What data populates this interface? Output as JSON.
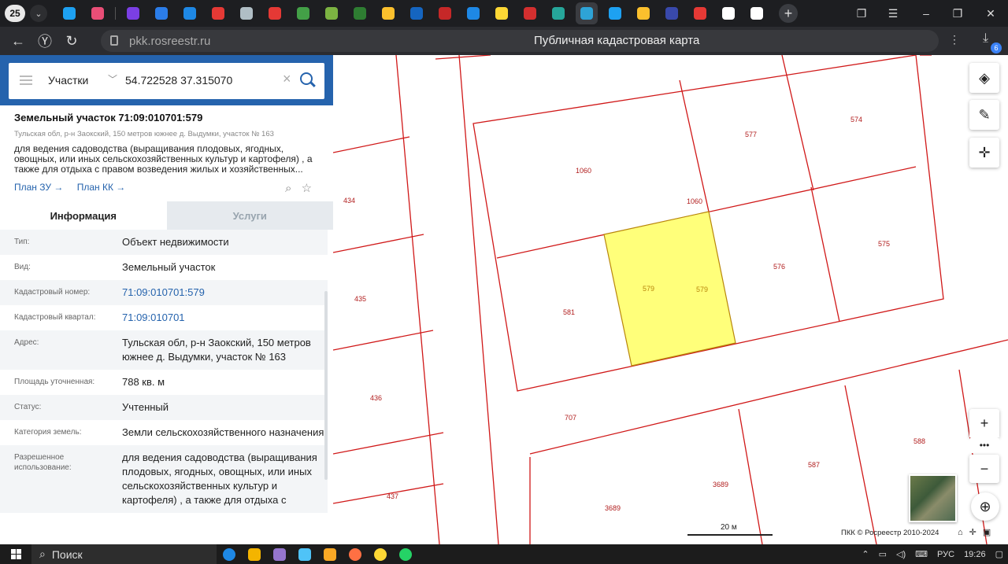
{
  "browser": {
    "tab_count": "25",
    "url": "pkk.rosreestr.ru",
    "page_title": "Публичная кадастровая карта",
    "downloads_badge": "6",
    "favicons": [
      "#1da1f2",
      "#e94e77",
      "#7b3fe4",
      "#2b7de9",
      "#1e88e5",
      "#e53935",
      "#b0bec5",
      "#e53935",
      "#43a047",
      "#7cb342",
      "#2e7d32",
      "#fbc02d",
      "#1565c0",
      "#c62828",
      "#1e88e5",
      "#fdd835",
      "#d32f2f",
      "#26a69a",
      "#2ea3d6",
      "#1da1f2",
      "#fbc02d",
      "#3949ab",
      "#e53935",
      "#ffffff",
      "#ffffff"
    ]
  },
  "search": {
    "type_label": "Участки",
    "value": "54.722528 37.315070"
  },
  "parcel": {
    "title": "Земельный участок 71:09:010701:579",
    "address_small": "Тульская обл, р-н Заокский, 150 метров южнее д. Выдумки, участок № 163",
    "description": "для ведения садоводства (выращивания плодовых, ягодных, овощных, или иных сельскохозяйственных культур и картофеля) , а также для отдыха с правом возведения жилых и хозяйственных...",
    "link_plan_zu": "План ЗУ →",
    "link_plan_kk": "План КК →"
  },
  "panel_tabs": {
    "info": "Информация",
    "services": "Услуги"
  },
  "info_rows": [
    {
      "label": "Тип:",
      "value": "Объект недвижимости"
    },
    {
      "label": "Вид:",
      "value": "Земельный участок"
    },
    {
      "label": "Кадастровый номер:",
      "value": "71:09:010701:579"
    },
    {
      "label": "Кадастровый квартал:",
      "value": "71:09:010701"
    },
    {
      "label": "Адрес:",
      "value": "Тульская обл, р-н Заокский, 150 метров южнее д. Выдумки, участок № 163"
    },
    {
      "label": "Площадь уточненная:",
      "value": "788 кв. м"
    },
    {
      "label": "Статус:",
      "value": "Учтенный"
    },
    {
      "label": "Категория земель:",
      "value": "Земли сельскохозяйственного назначения"
    },
    {
      "label": "Разрешенное использование:",
      "value": "для ведения садоводства (выращивания плодовых, ягодных, овощных, или иных сельскохозяйственных культур и картофеля) , а также для отдыха с"
    }
  ],
  "map": {
    "labels": [
      "1060",
      "1060",
      "577",
      "574",
      "434",
      "575",
      "576",
      "579",
      "579",
      "581",
      "435",
      "436",
      "707",
      "3689",
      "3689",
      "587",
      "588",
      "437"
    ],
    "scale_label": "20 м",
    "copyright": "ПКК © Росреестр 2010-2024",
    "parcel_color": "#ffff7a",
    "boundary_color": "#d01818"
  },
  "taskbar": {
    "search_label": "Поиск",
    "lang": "РУС",
    "time": "19:26"
  }
}
